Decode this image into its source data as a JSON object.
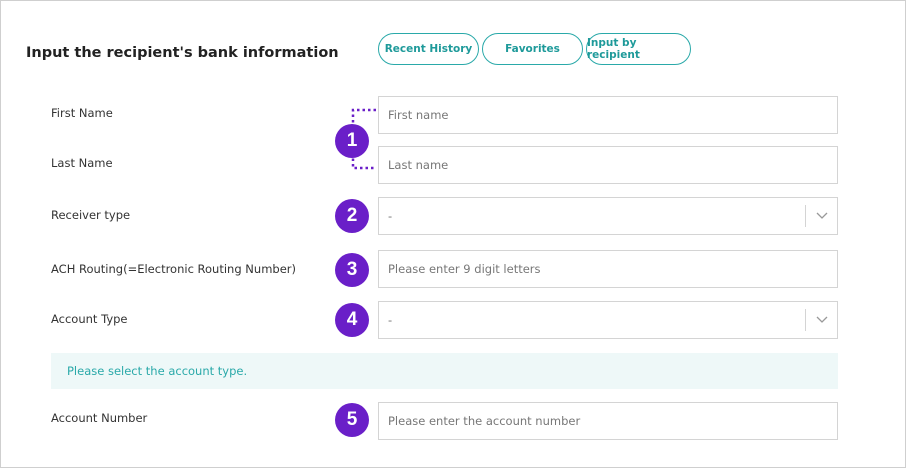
{
  "header": {
    "title": "Input the recipient's bank information",
    "tabs": [
      {
        "label": "Recent History"
      },
      {
        "label": "Favorites"
      },
      {
        "label": "Input by recipient"
      }
    ]
  },
  "form": {
    "first_name": {
      "label": "First Name",
      "placeholder": "First name"
    },
    "last_name": {
      "label": "Last Name",
      "placeholder": "Last name"
    },
    "receiver_type": {
      "label": "Receiver type",
      "value": "-"
    },
    "ach_routing": {
      "label": "ACH Routing(=Electronic Routing Number)",
      "placeholder": "Please enter 9 digit letters"
    },
    "account_type": {
      "label": "Account Type",
      "value": "-"
    },
    "notice": "Please select the account type.",
    "account_number": {
      "label": "Account Number",
      "placeholder": "Please enter the account number"
    }
  },
  "badges": [
    "1",
    "2",
    "3",
    "4",
    "5"
  ],
  "colors": {
    "accent": "#2aa9a9",
    "badge": "#6a1fc8",
    "notice_bg": "#eef8f8",
    "border": "#d4d4d4"
  },
  "icons": {
    "select_arrow": "chevron-down-icon"
  }
}
